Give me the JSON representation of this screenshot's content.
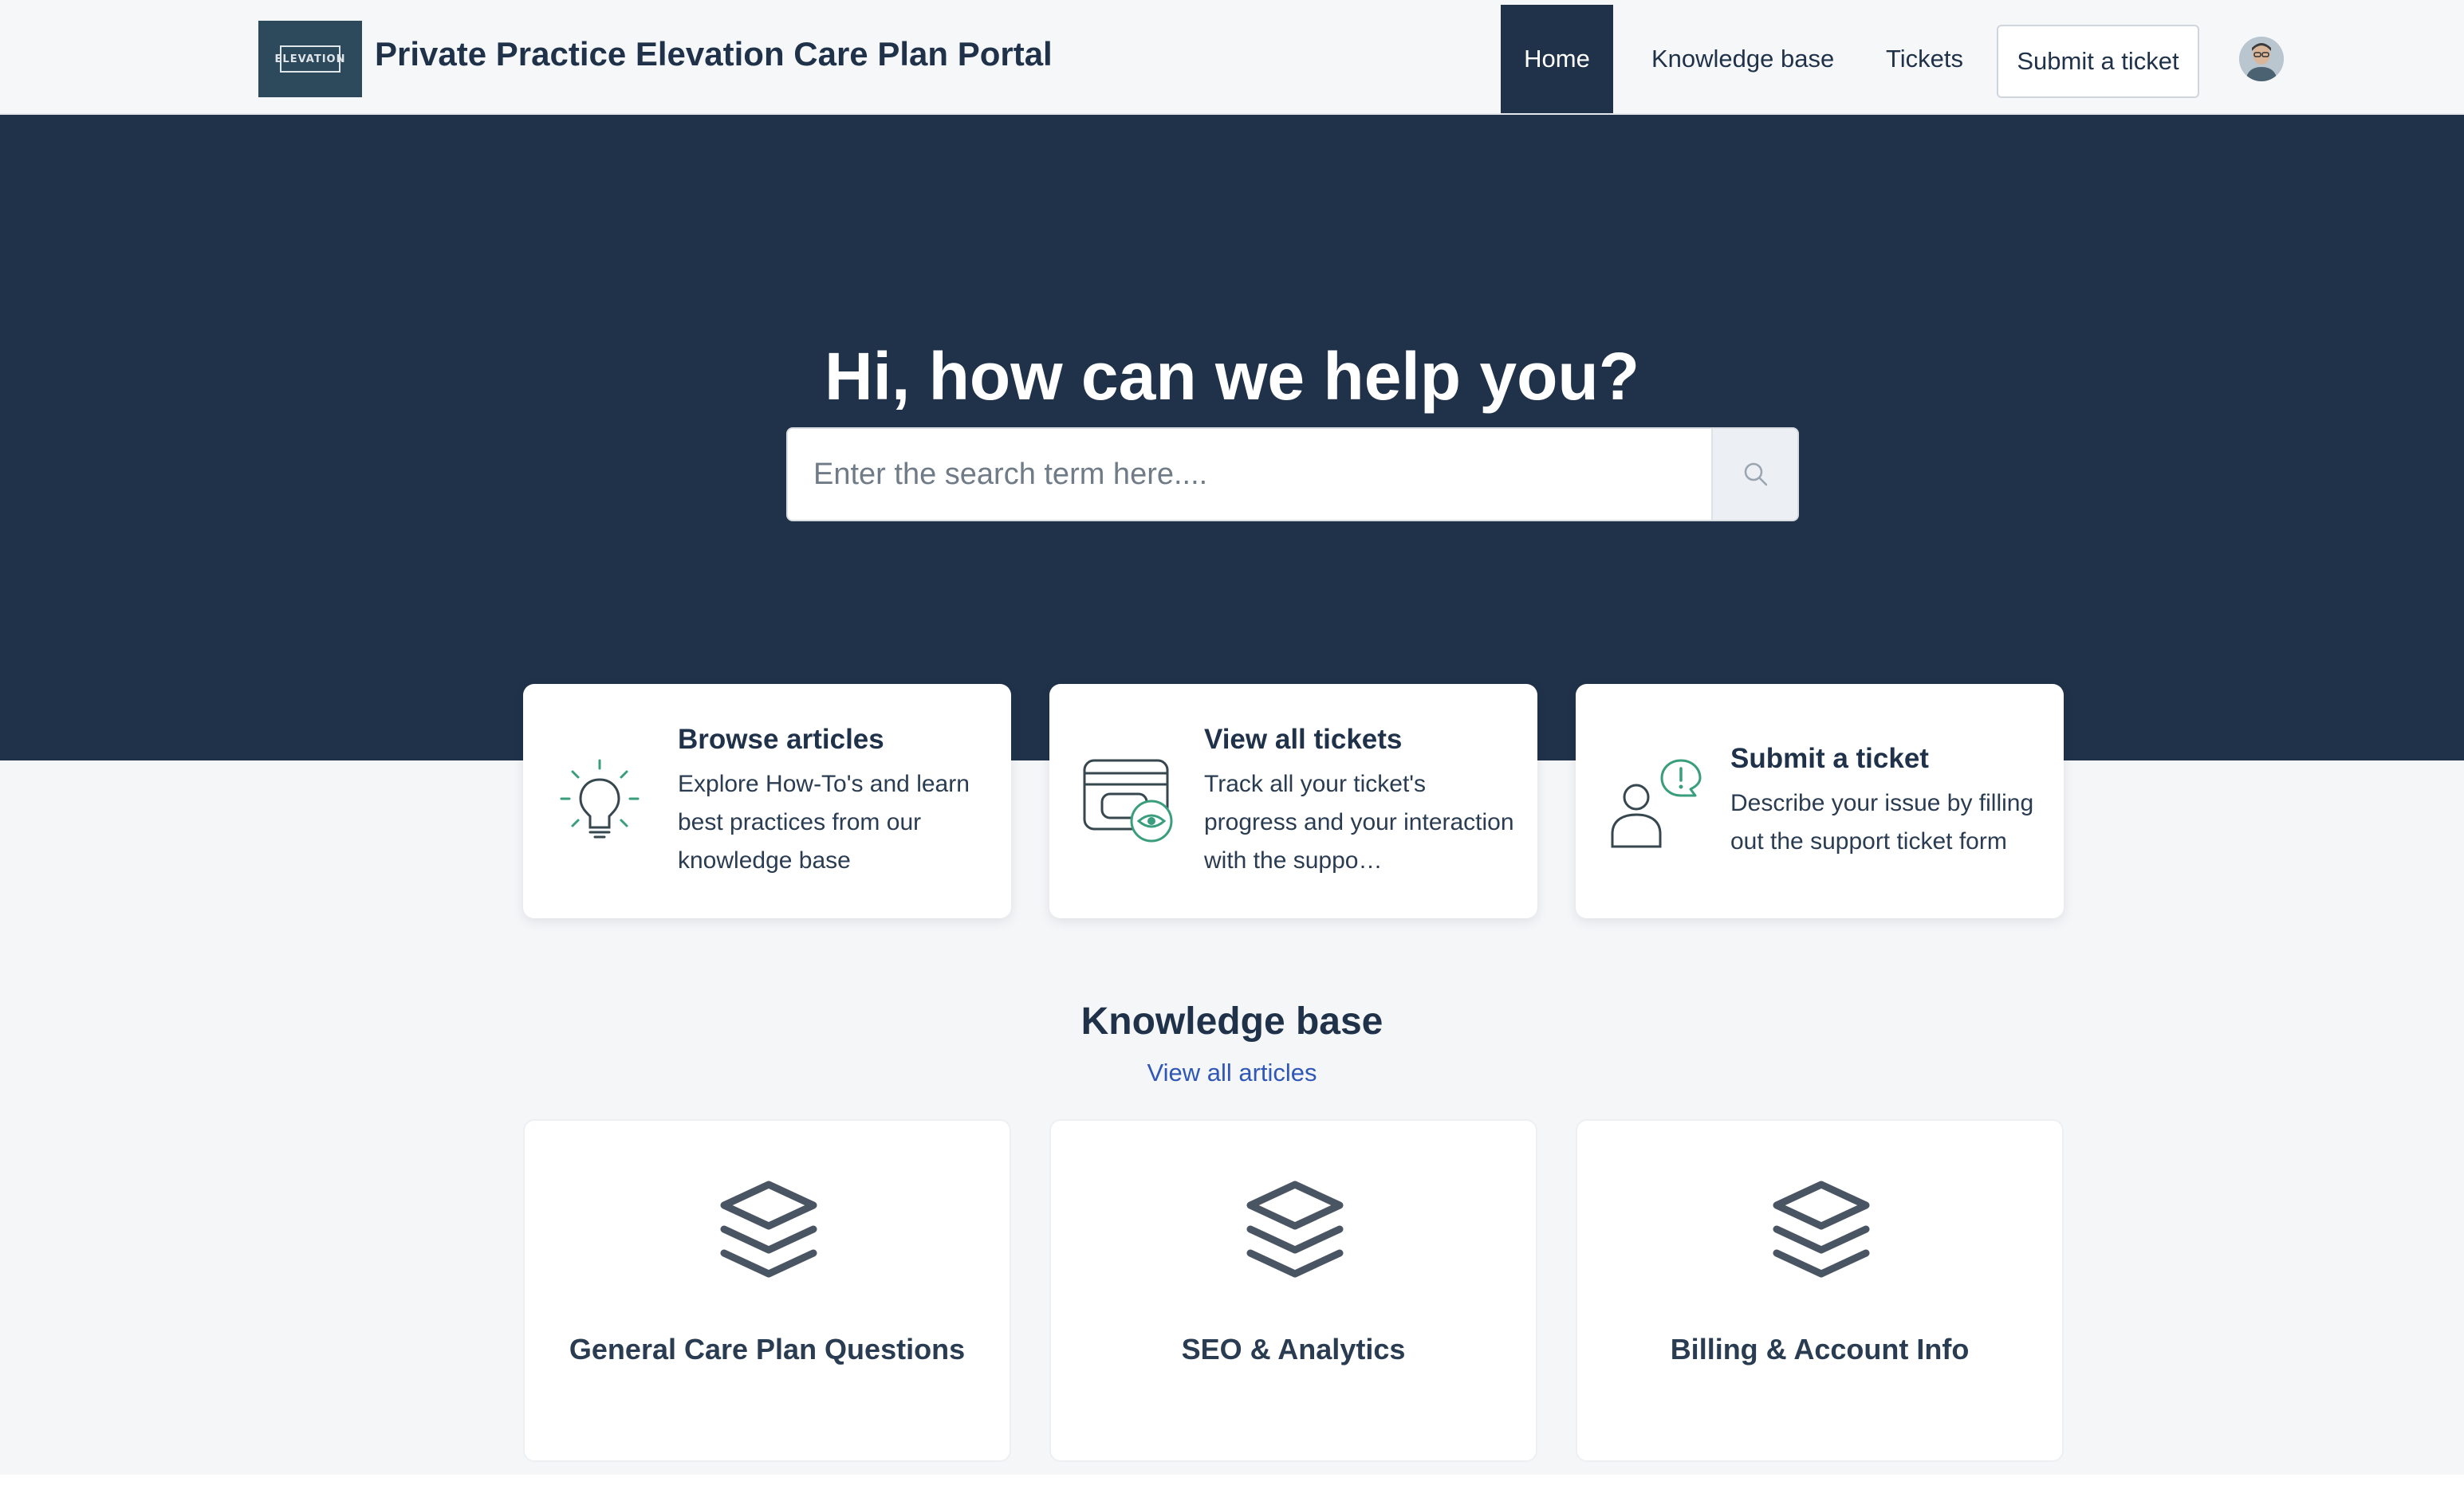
{
  "header": {
    "logo_text": "ELEVATION",
    "site_title": "Private Practice Elevation Care Plan Portal",
    "nav": {
      "home": "Home",
      "knowledge_base": "Knowledge base",
      "tickets": "Tickets",
      "submit_ticket": "Submit a ticket"
    },
    "avatar_icon": "user-avatar"
  },
  "hero": {
    "title": "Hi, how can we help you?",
    "search": {
      "placeholder": "Enter the search term here....",
      "value": "",
      "button_icon": "search-icon"
    }
  },
  "actions": [
    {
      "title": "Browse articles",
      "description": "Explore How-To's and learn best practices from our knowledge base",
      "icon": "lightbulb-icon"
    },
    {
      "title": "View all tickets",
      "description": "Track all your ticket's progress and your interaction with the suppo…",
      "icon": "tickets-view-icon"
    },
    {
      "title": "Submit a ticket",
      "description": "Describe your issue by filling out the support ticket form",
      "icon": "user-alert-icon"
    }
  ],
  "knowledge_base": {
    "heading": "Knowledge base",
    "view_all": "View all articles",
    "categories": [
      {
        "title": "General Care Plan Questions",
        "icon": "layers-icon"
      },
      {
        "title": "SEO & Analytics",
        "icon": "layers-icon"
      },
      {
        "title": "Billing & Account Info",
        "icon": "layers-icon"
      }
    ]
  },
  "colors": {
    "navy": "#1f3249",
    "accent_green": "#3a9e7e",
    "link_blue": "#2f57b7",
    "page_bg": "#f5f6f8"
  }
}
